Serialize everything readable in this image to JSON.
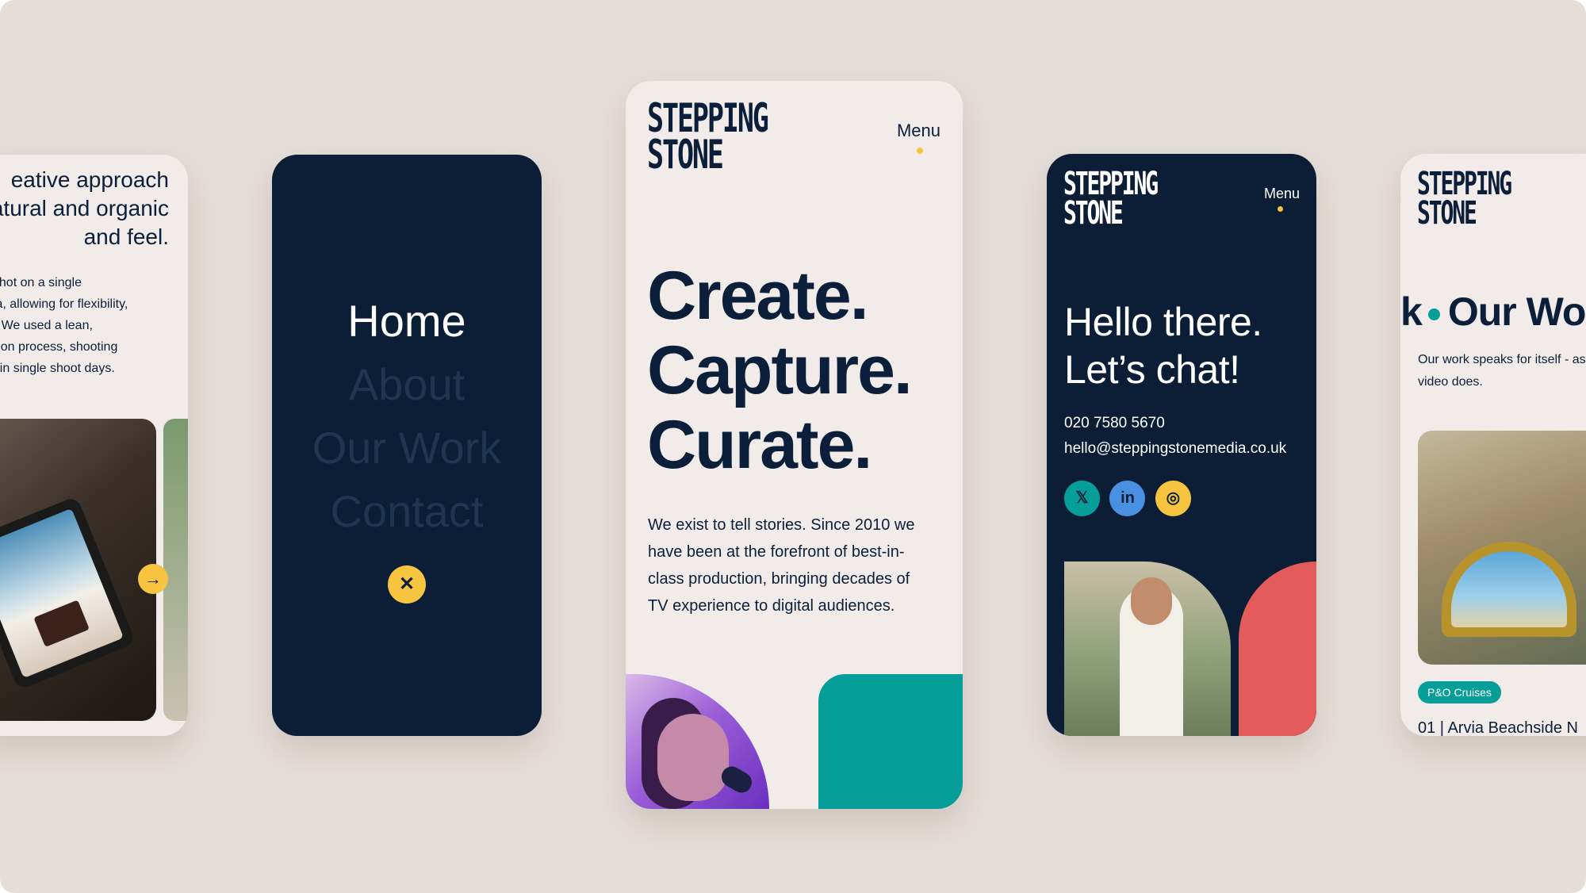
{
  "brand": {
    "logo_line1": "STEPPING",
    "logo_line2": "STONE",
    "colors": {
      "navy": "#0b1e36",
      "cream": "#f1ece9",
      "yellow": "#f6c43f",
      "teal": "#069e98",
      "coral": "#e35b5b",
      "blue": "#4a90e2"
    }
  },
  "about_screen": {
    "heading_lines": [
      "eative approach",
      "atural and organic",
      " and feel."
    ],
    "body_lines": [
      " was shot on a single",
      "amera, allowing for flexibility,",
      " ease. We used a lean,",
      "oduction process, shooting",
      "cipes in single shoot days."
    ],
    "next_icon": "arrow-right-icon"
  },
  "menu_screen": {
    "items": [
      {
        "label": "Home",
        "active": true
      },
      {
        "label": "About",
        "active": false
      },
      {
        "label": "Our Work",
        "active": false
      },
      {
        "label": "Contact",
        "active": false
      }
    ],
    "close_icon": "close-icon"
  },
  "home_screen": {
    "menu_label": "Menu",
    "hero_lines": [
      "Create.",
      "Capture.",
      "Curate."
    ],
    "intro_lines": [
      "We exist to tell stories. Since 2010 we",
      "have been at the forefront of best-in-",
      "class production, bringing decades of",
      "TV experience to digital audiences."
    ]
  },
  "contact_screen": {
    "menu_label": "Menu",
    "heading_lines": [
      "Hello there.",
      "Let’s chat!"
    ],
    "phone": "020 7580 5670",
    "email": "hello@steppingstonemedia.co.uk",
    "socials": [
      {
        "icon": "x-twitter-icon",
        "glyph": "𝕏",
        "color": "#069e98"
      },
      {
        "icon": "linkedin-icon",
        "glyph": "in",
        "color": "#4a90e2"
      },
      {
        "icon": "instagram-icon",
        "glyph": "◎",
        "color": "#f6c43f"
      }
    ]
  },
  "work_screen": {
    "heading_prefix": "k",
    "heading": "Our Wo",
    "body_lines": [
      "Our work speaks for itself - as",
      "video does."
    ],
    "tag": "P&O Cruises",
    "case_title": "01 | Arvia Beachside N"
  }
}
